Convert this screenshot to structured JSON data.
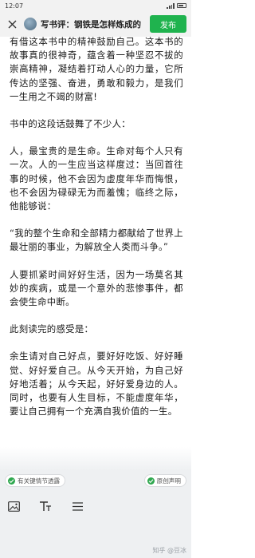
{
  "status_bar": {
    "time": "12:07"
  },
  "header": {
    "title": "写书评：钢铁是怎样炼成的",
    "publish_label": "发布"
  },
  "article": {
    "paragraphs": [
      "有借这本书中的精神鼓励自己。这本书的故事真的很神奇，蕴含着一种坚忍不拔的崇高精神，凝结着打动人心的力量，它所传达的坚强、奋进，勇敢和毅力，是我们一生用之不竭的财富!",
      "书中的这段话鼓舞了不少人：",
      "人，最宝贵的是生命。生命对每个人只有一次。人的一生应当这样度过：当回首往事的时候，他不会因为虚度年华而悔恨，也不会因为碌碌无为而羞愧；临终之际，他能够说：",
      "“我的整个生命和全部精力都献给了世界上最壮丽的事业，为解放全人类而斗争。”",
      "人要抓紧时间好好生活，因为一场莫名其妙的疾病，或是一个意外的悲惨事件，都会使生命中断。",
      "此刻读完的感受是：",
      "余生请对自己好点，要好好吃饭、好好睡觉、好好爱自己。从今天开始，为自己好好地活着；从今天起，好好爱身边的人。同时，也要有人生目标，不能虚度年华，要让自己拥有一个充满自我价值的一生。"
    ]
  },
  "options": {
    "spoiler_label": "有关键情节透露",
    "original_label": "原创声明"
  },
  "watermark": "知乎 @豆冰",
  "icons": {
    "close": "close-icon",
    "image": "image-icon",
    "text_format": "text-format-icon",
    "divider": "divider-icon"
  },
  "colors": {
    "accent": "#1fb34e",
    "check": "#2fa84f"
  }
}
